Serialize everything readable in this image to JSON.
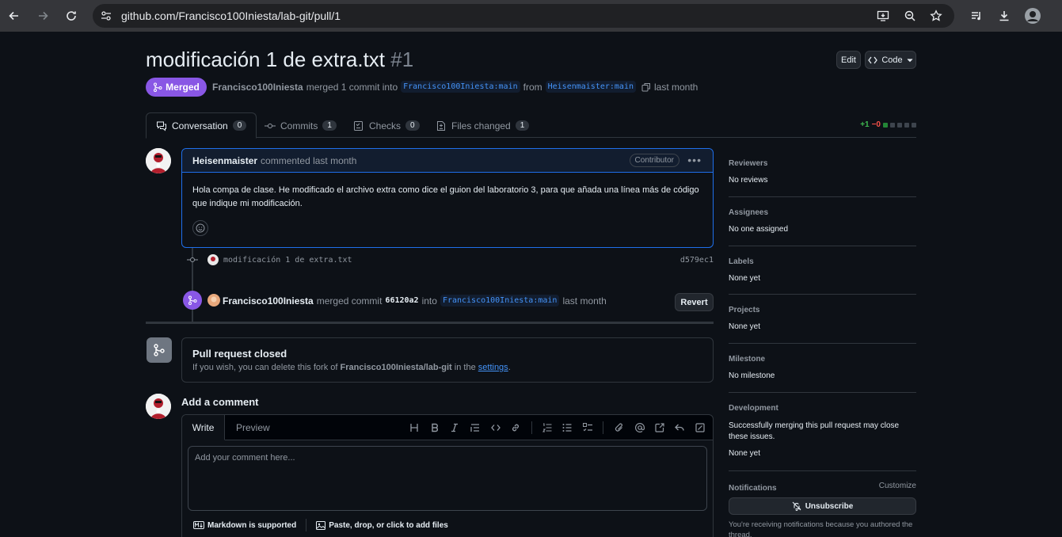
{
  "browser": {
    "url": "github.com/Francisco100Iniesta/lab-git/pull/1"
  },
  "header": {
    "title": "modificación 1 de extra.txt",
    "number": "#1",
    "edit_label": "Edit",
    "code_label": "Code",
    "status": "Merged",
    "author": "Francisco100Iniesta",
    "merged_text": "merged 1 commit into",
    "base_branch": "Francisco100Iniesta:main",
    "from_text": "from",
    "head_branch": "Heisenmaister:main",
    "time": "last month"
  },
  "tabs": [
    {
      "label": "Conversation",
      "count": "0"
    },
    {
      "label": "Commits",
      "count": "1"
    },
    {
      "label": "Checks",
      "count": "0"
    },
    {
      "label": "Files changed",
      "count": "1"
    }
  ],
  "diffstat": {
    "added": "+1",
    "removed": "−0"
  },
  "comment": {
    "author": "Heisenmaister",
    "action": "commented last month",
    "badge": "Contributor",
    "body": "Hola compa de clase. He modificado el archivo extra como dice el guion del laboratorio 3, para que añada una línea más de código que indique mi modificación."
  },
  "commit": {
    "message": "modificación 1 de extra.txt",
    "sha": "d579ec1"
  },
  "merge_event": {
    "author": "Francisco100Iniesta",
    "text": "merged commit",
    "sha": "66120a2",
    "into": "into",
    "branch": "Francisco100Iniesta:main",
    "time": "last month",
    "revert_label": "Revert"
  },
  "closed": {
    "title": "Pull request closed",
    "sub_prefix": "If you wish, you can delete this fork of",
    "repo": "Francisco100Iniesta/lab-git",
    "sub_mid": "in the",
    "link": "settings",
    "sub_end": "."
  },
  "add_comment": {
    "title": "Add a comment",
    "write_tab": "Write",
    "preview_tab": "Preview",
    "placeholder": "Add your comment here...",
    "markdown_label": "Markdown is supported",
    "files_label": "Paste, drop, or click to add files"
  },
  "sidebar": {
    "reviewers": {
      "heading": "Reviewers",
      "value": "No reviews"
    },
    "assignees": {
      "heading": "Assignees",
      "value": "No one assigned"
    },
    "labels": {
      "heading": "Labels",
      "value": "None yet"
    },
    "projects": {
      "heading": "Projects",
      "value": "None yet"
    },
    "milestone": {
      "heading": "Milestone",
      "value": "No milestone"
    },
    "development": {
      "heading": "Development",
      "text": "Successfully merging this pull request may close these issues.",
      "value": "None yet"
    },
    "notifications": {
      "heading": "Notifications",
      "customize": "Customize",
      "unsubscribe": "Unsubscribe",
      "note": "You're receiving notifications because you authored the thread."
    }
  },
  "colors": {
    "merged": "#8957e5",
    "link": "#4493f8",
    "add": "#3fb950",
    "del": "#f85149",
    "bg": "#0d1117"
  }
}
